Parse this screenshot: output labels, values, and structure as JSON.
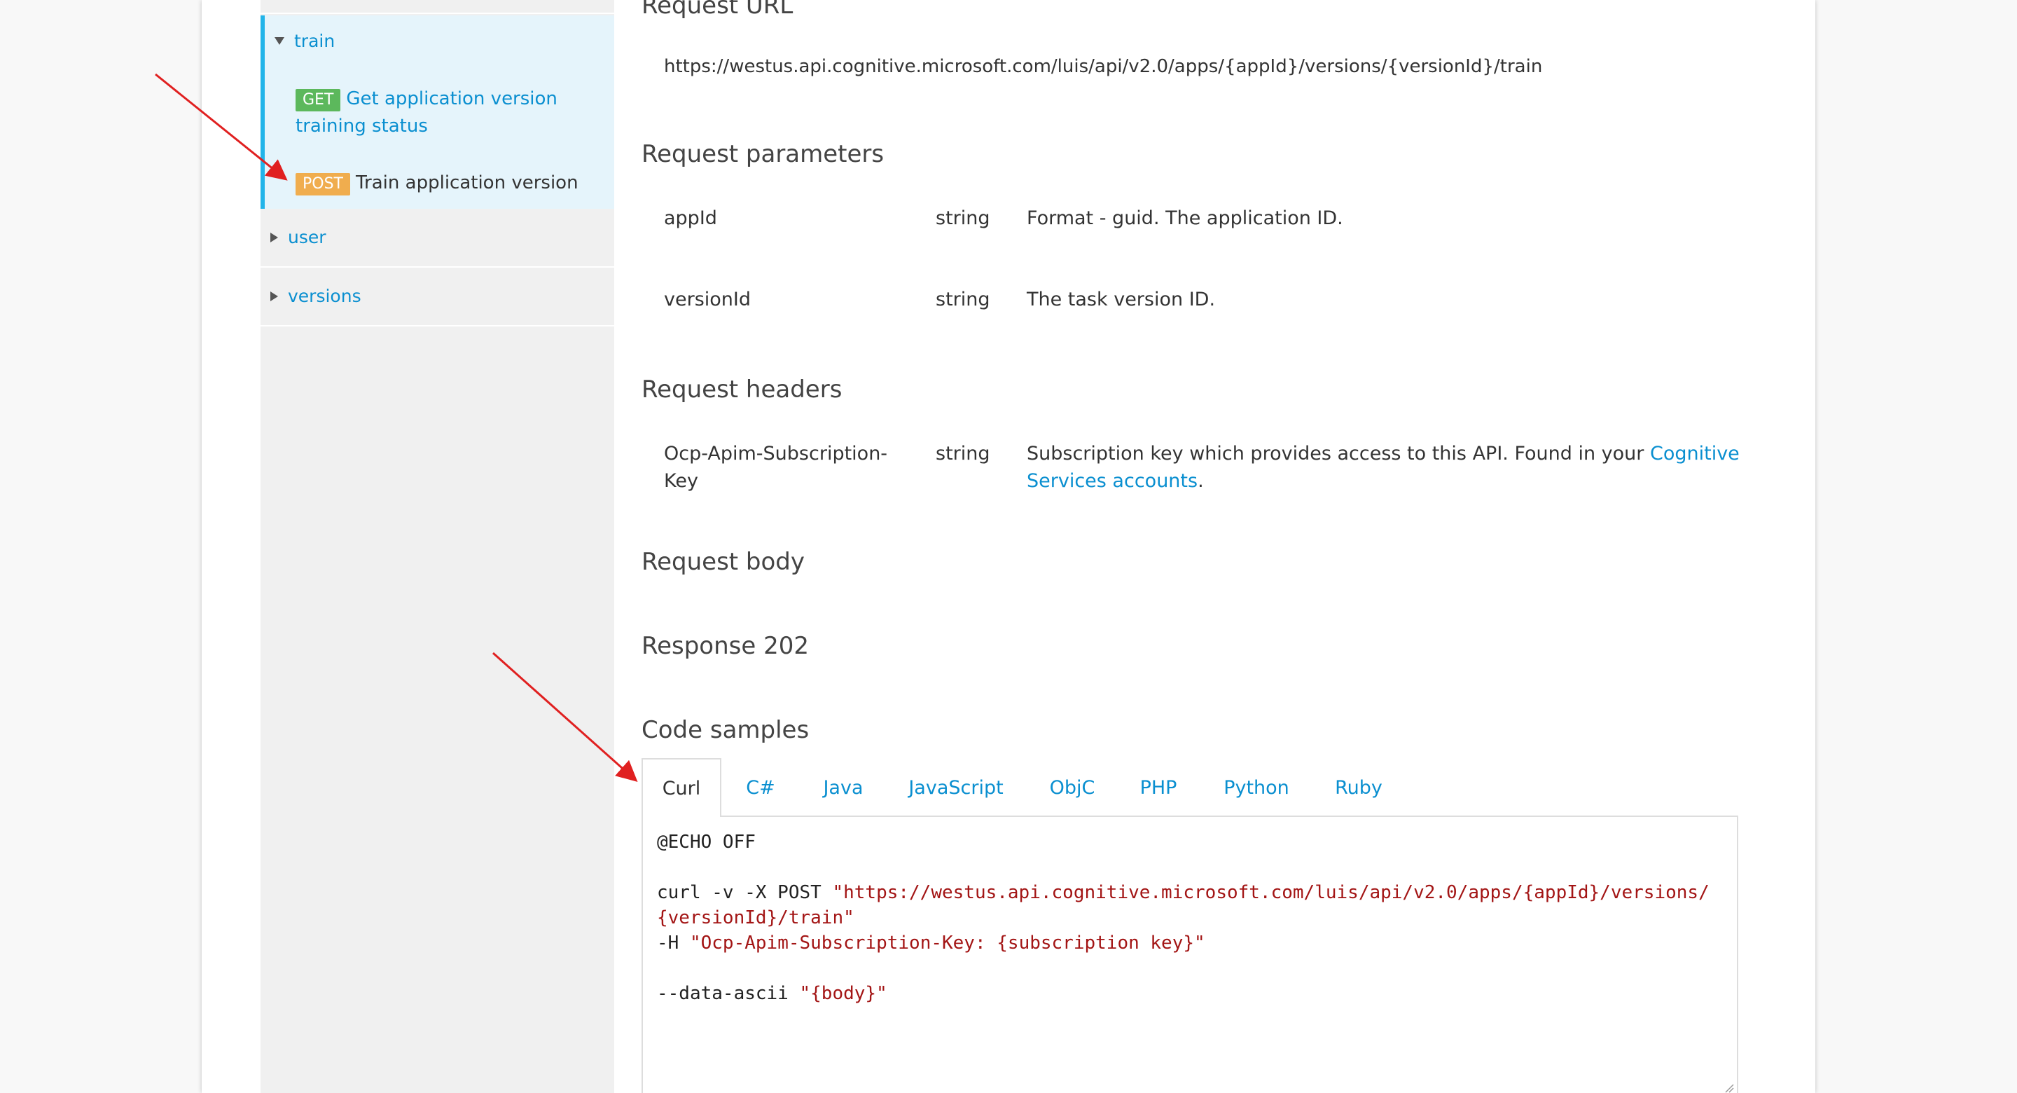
{
  "sidebar": {
    "train_group": {
      "label": "train",
      "ops": [
        {
          "method": "GET",
          "label_line1": "Get application version",
          "label_line2": "training status"
        },
        {
          "method": "POST",
          "label": "Train application version"
        }
      ]
    },
    "user_label": "user",
    "versions_label": "versions"
  },
  "main": {
    "request_url_title": "Request URL",
    "request_url": "https://westus.api.cognitive.microsoft.com/luis/api/v2.0/apps/{appId}/versions/{versionId}/train",
    "request_params_title": "Request parameters",
    "params": [
      {
        "name": "appId",
        "type": "string",
        "desc": "Format - guid. The application ID."
      },
      {
        "name": "versionId",
        "type": "string",
        "desc": "The task version ID."
      }
    ],
    "request_headers_title": "Request headers",
    "header": {
      "name_line1": "Ocp-Apim-Subscription-",
      "name_line2": "Key",
      "type": "string",
      "desc_prefix": "Subscription key which provides access to this API. Found in your ",
      "desc_link_a": "Cognitive",
      "desc_link_b": "Services accounts",
      "desc_suffix": "."
    },
    "request_body_title": "Request body",
    "response_title": "Response 202",
    "code_samples_title": "Code samples",
    "tabs": [
      "Curl",
      "C#",
      "Java",
      "JavaScript",
      "ObjC",
      "PHP",
      "Python",
      "Ruby"
    ],
    "code": {
      "l1": "@ECHO OFF",
      "l3_plain": "curl -v -X POST ",
      "l3_str": "\"https://westus.api.cognitive.microsoft.com/luis/api/v2.0/apps/{appId}/versions/",
      "l4_str": "{versionId}/train\"",
      "l5_plain": "-H ",
      "l5_str": "\"Ocp-Apim-Subscription-Key: {subscription key}\"",
      "l7_plain": "--data-ascii ",
      "l7_str": "\"{body}\""
    }
  },
  "colors": {
    "link": "#0a8fd0",
    "get_badge": "#5cb85c",
    "post_badge": "#f0ad4e",
    "arrow": "#e02020"
  }
}
